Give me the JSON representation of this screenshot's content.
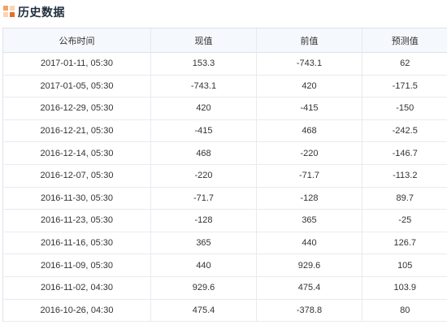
{
  "section": {
    "title": "历史数据",
    "icon": "bar-grid-icon"
  },
  "table": {
    "headers": [
      "公布时间",
      "现值",
      "前值",
      "预测值"
    ],
    "rows": [
      [
        "2017-01-11, 05:30",
        "153.3",
        "-743.1",
        "62"
      ],
      [
        "2017-01-05, 05:30",
        "-743.1",
        "420",
        "-171.5"
      ],
      [
        "2016-12-29, 05:30",
        "420",
        "-415",
        "-150"
      ],
      [
        "2016-12-21, 05:30",
        "-415",
        "468",
        "-242.5"
      ],
      [
        "2016-12-14, 05:30",
        "468",
        "-220",
        "-146.7"
      ],
      [
        "2016-12-07, 05:30",
        "-220",
        "-71.7",
        "-113.2"
      ],
      [
        "2016-11-30, 05:30",
        "-71.7",
        "-128",
        "89.7"
      ],
      [
        "2016-11-23, 05:30",
        "-128",
        "365",
        "-25"
      ],
      [
        "2016-11-16, 05:30",
        "365",
        "440",
        "126.7"
      ],
      [
        "2016-11-09, 05:30",
        "440",
        "929.6",
        "105"
      ],
      [
        "2016-11-02, 04:30",
        "929.6",
        "475.4",
        "103.9"
      ],
      [
        "2016-10-26, 04:30",
        "475.4",
        "-378.8",
        "80"
      ]
    ]
  },
  "colors": {
    "accent": "#e76f24",
    "header_bg": "#f5f8fc",
    "border": "#e6ebf0",
    "text": "#333333"
  }
}
